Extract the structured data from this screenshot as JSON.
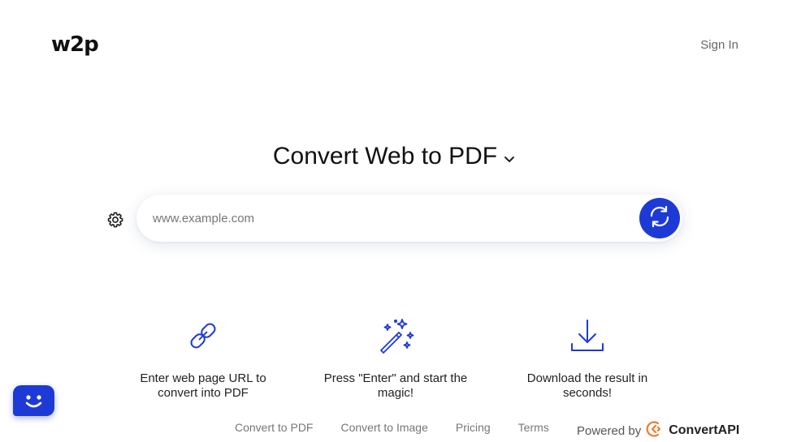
{
  "header": {
    "logo": "w2p",
    "sign_in": "Sign In"
  },
  "hero": {
    "title": "Convert Web to PDF"
  },
  "search": {
    "placeholder": "www.example.com",
    "value": ""
  },
  "features": [
    {
      "icon": "link-icon",
      "text": "Enter web page URL to convert into PDF"
    },
    {
      "icon": "magic-wand-icon",
      "text": "Press \"Enter\" and start the magic!"
    },
    {
      "icon": "download-icon",
      "text": "Download the result in seconds!"
    }
  ],
  "footer": {
    "links": [
      "Convert to PDF",
      "Convert to Image",
      "Pricing",
      "Terms"
    ],
    "powered_by": "Powered by",
    "brand": "ConvertAPI"
  },
  "colors": {
    "accent": "#1e3ad6",
    "brand_orange": "#f07b2a"
  }
}
